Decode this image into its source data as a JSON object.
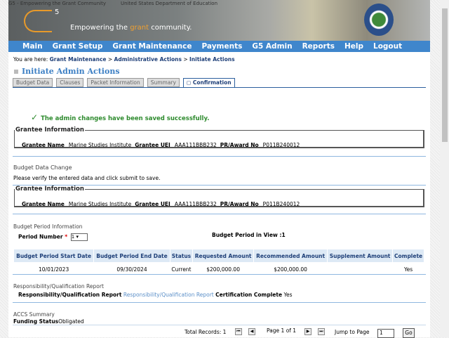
{
  "header": {
    "logo_alt": "G5 - Empowering the Grant Community",
    "seal_alt": "United States Department of Education",
    "logo_mark": "5",
    "tagline_pre": "Empowering the ",
    "tagline_accent": "grant",
    "tagline_post": " community."
  },
  "nav": [
    "Main",
    "Grant Setup",
    "Grant Maintenance",
    "Payments",
    "G5 Admin",
    "Reports",
    "Help",
    "Logout"
  ],
  "breadcrumb": {
    "prefix": "You are here: ",
    "items": [
      "Grant Maintenance",
      "Administrative Actions",
      "Initiate Actions"
    ],
    "sep": " > "
  },
  "page_title": "Initiate Admin Actions",
  "tabs": [
    "Budget Data",
    "Clauses",
    "Packet Information",
    "Summary",
    "Confirmation"
  ],
  "success": "The admin changes have been saved successfully.",
  "grantee": {
    "legend": "Grantee Information",
    "name_label": "Grantee Name",
    "name": "Marine Studies Institute",
    "uei_label": "Grantee UEI",
    "uei": "AAA111BBB232",
    "award_label": "PR/Award No",
    "award": "P011B240012"
  },
  "budget_change": {
    "title": "Budget Data Change",
    "note": "Please verify the entered data and click submit to save."
  },
  "budget_period": {
    "title": "Budget Period Information",
    "period_label": "Period Number",
    "required": "*",
    "period_value": "1",
    "in_view": "Budget Period in View :1",
    "columns": [
      "Budget Period Start Date",
      "Budget Period End Date",
      "Status",
      "Requested Amount",
      "Recommended Amount",
      "Supplement Amount",
      "Complete"
    ],
    "rows": [
      [
        "10/01/2023",
        "09/30/2024",
        "Current",
        "$200,000.00",
        "$200,000.00",
        "",
        "Yes"
      ]
    ]
  },
  "rqr": {
    "title": "Responsibility/Qualification Report",
    "label": "Responsibility/Qualification Report",
    "link": "Responsibility/Qualification Report",
    "cert_label": "Certification Complete",
    "cert_value": "Yes"
  },
  "accs": {
    "title": "ACCS Summary",
    "label": "Funding Status",
    "value": "Obligated"
  },
  "pagination": {
    "total": "Total Records: 1",
    "page": "Page 1 of 1",
    "jump_label": "Jump to Page",
    "jump_value": "1",
    "go": "Go"
  }
}
